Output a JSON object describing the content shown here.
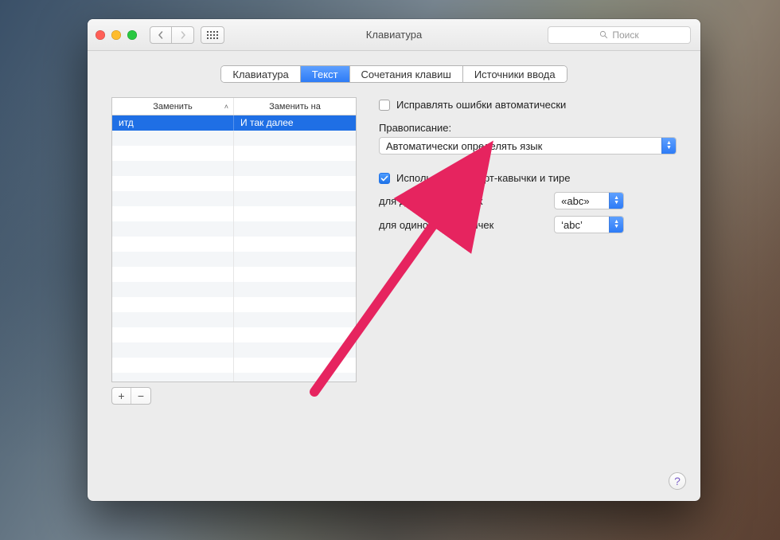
{
  "window": {
    "title": "Клавиатура"
  },
  "toolbar": {
    "search_placeholder": "Поиск"
  },
  "tabs": {
    "items": [
      "Клавиатура",
      "Текст",
      "Сочетания клавиш",
      "Источники ввода"
    ],
    "active_index": 1
  },
  "table": {
    "headers": {
      "replace": "Заменить",
      "with": "Заменить на"
    },
    "rows": [
      {
        "from": "итд",
        "to": "И так далее"
      }
    ],
    "blank_rows": 17
  },
  "buttons": {
    "add": "+",
    "remove": "−"
  },
  "options": {
    "autocorrect": {
      "label": "Исправлять ошибки автоматически",
      "checked": false
    },
    "spelling_heading": "Правописание:",
    "spelling_value": "Автоматически определять язык",
    "smart_quotes": {
      "label": "Использовать смарт-кавычки и тире",
      "checked": true
    },
    "double_quotes_label": "для двойных кавычек",
    "double_quotes_value": "«abc»",
    "single_quotes_label": "для одиночных кавычек",
    "single_quotes_value": "‘abc’"
  },
  "help": "?",
  "colors": {
    "accent": "#2d7bf6",
    "arrow": "#e6245f"
  }
}
